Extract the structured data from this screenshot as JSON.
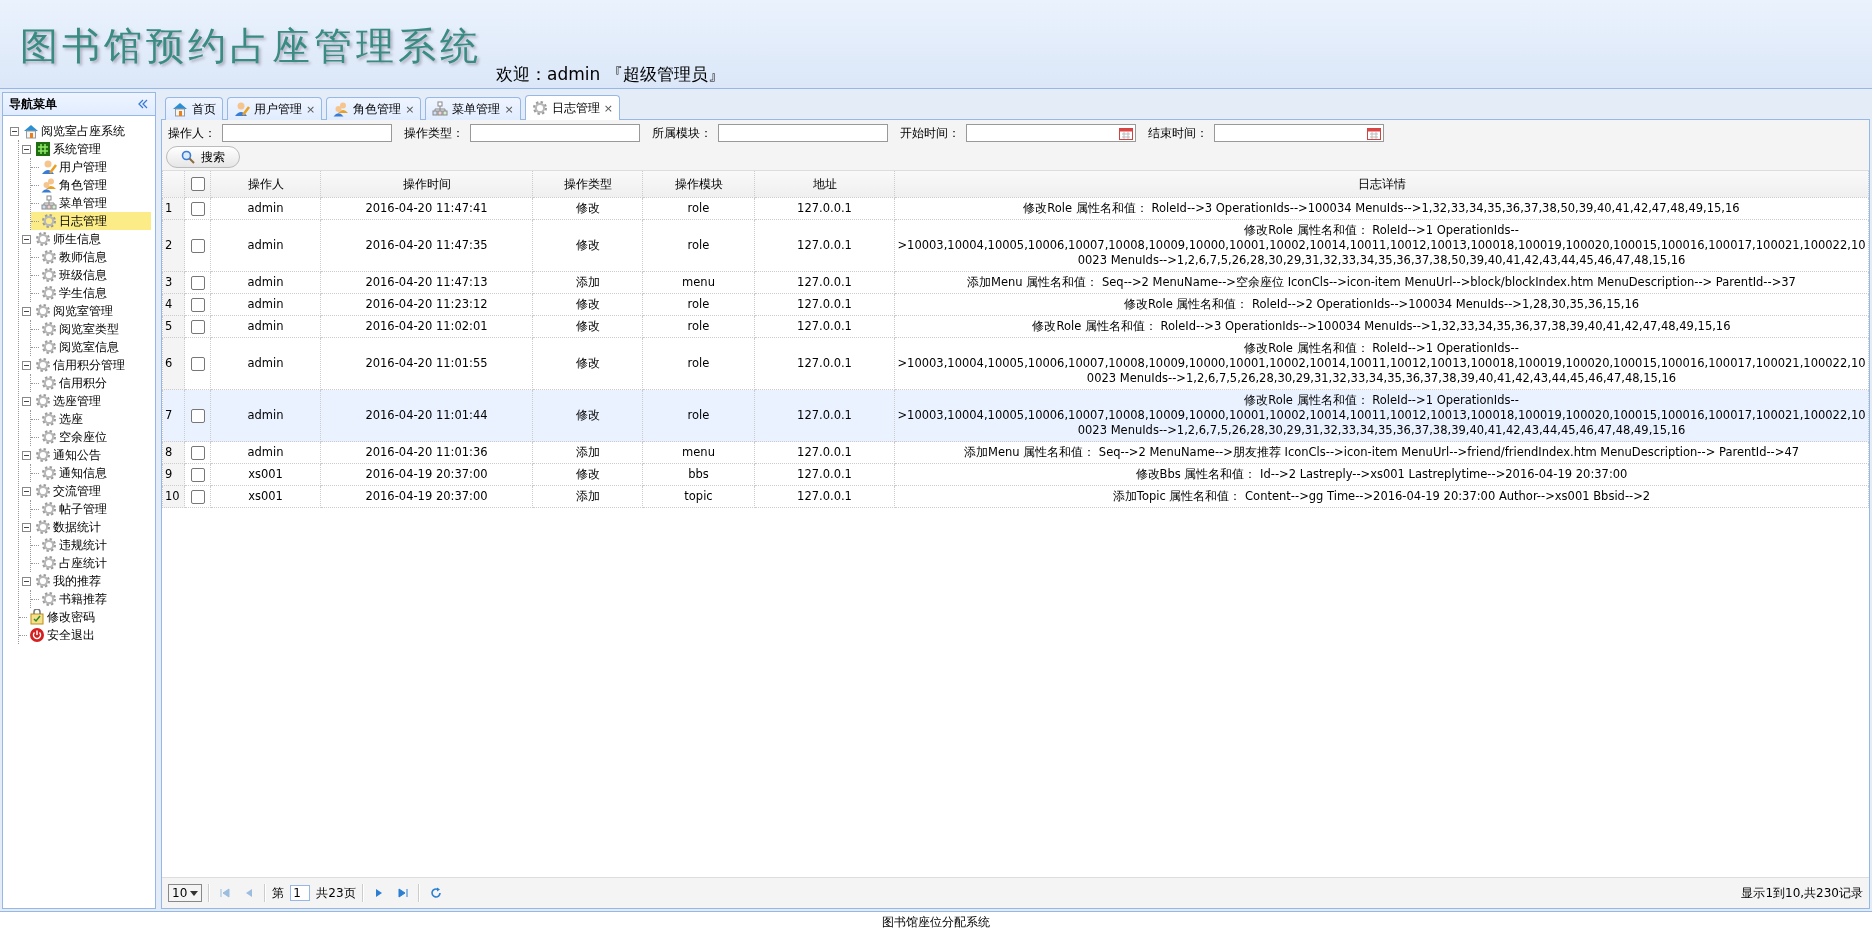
{
  "header": {
    "title": "图书馆预约占座管理系统",
    "welcome": "欢迎：admin 『超级管理员』"
  },
  "sidebar": {
    "title": "导航菜单",
    "tree": [
      {
        "label": "阅览室占座系统",
        "kind": "home",
        "expanded": true,
        "selected": false,
        "children": [
          {
            "label": "系统管理",
            "kind": "hash",
            "expanded": true,
            "selected": false,
            "children": [
              {
                "label": "用户管理",
                "kind": "user",
                "selected": false
              },
              {
                "label": "角色管理",
                "kind": "users",
                "selected": false
              },
              {
                "label": "菜单管理",
                "kind": "sitemap",
                "selected": false
              },
              {
                "label": "日志管理",
                "kind": "gear",
                "selected": true
              }
            ]
          },
          {
            "label": "师生信息",
            "kind": "gear",
            "expanded": true,
            "selected": false,
            "children": [
              {
                "label": "教师信息",
                "kind": "gear",
                "selected": false
              },
              {
                "label": "班级信息",
                "kind": "gear",
                "selected": false
              },
              {
                "label": "学生信息",
                "kind": "gear",
                "selected": false
              }
            ]
          },
          {
            "label": "阅览室管理",
            "kind": "gear",
            "expanded": true,
            "selected": false,
            "children": [
              {
                "label": "阅览室类型",
                "kind": "gear",
                "selected": false
              },
              {
                "label": "阅览室信息",
                "kind": "gear",
                "selected": false
              }
            ]
          },
          {
            "label": "信用积分管理",
            "kind": "gear",
            "expanded": true,
            "selected": false,
            "children": [
              {
                "label": "信用积分",
                "kind": "gear",
                "selected": false
              }
            ]
          },
          {
            "label": "选座管理",
            "kind": "gear",
            "expanded": true,
            "selected": false,
            "children": [
              {
                "label": "选座",
                "kind": "gear",
                "selected": false
              },
              {
                "label": "空余座位",
                "kind": "gear",
                "selected": false
              }
            ]
          },
          {
            "label": "通知公告",
            "kind": "gear",
            "expanded": true,
            "selected": false,
            "children": [
              {
                "label": "通知信息",
                "kind": "gear",
                "selected": false
              }
            ]
          },
          {
            "label": "交流管理",
            "kind": "gear",
            "expanded": true,
            "selected": false,
            "children": [
              {
                "label": "帖子管理",
                "kind": "gear",
                "selected": false
              }
            ]
          },
          {
            "label": "数据统计",
            "kind": "gear",
            "expanded": true,
            "selected": false,
            "children": [
              {
                "label": "违规统计",
                "kind": "gear",
                "selected": false
              },
              {
                "label": "占座统计",
                "kind": "gear",
                "selected": false
              }
            ]
          },
          {
            "label": "我的推荐",
            "kind": "gear",
            "expanded": true,
            "selected": false,
            "children": [
              {
                "label": "书籍推荐",
                "kind": "gear",
                "selected": false
              }
            ]
          },
          {
            "label": "修改密码",
            "kind": "notepad",
            "selected": false
          },
          {
            "label": "安全退出",
            "kind": "power",
            "selected": false
          }
        ]
      }
    ]
  },
  "tabs": [
    {
      "label": "首页",
      "kind": "home",
      "closable": false,
      "selected": false
    },
    {
      "label": "用户管理",
      "kind": "user",
      "closable": true,
      "selected": false
    },
    {
      "label": "角色管理",
      "kind": "users",
      "closable": true,
      "selected": false
    },
    {
      "label": "菜单管理",
      "kind": "sitemap",
      "closable": true,
      "selected": false
    },
    {
      "label": "日志管理",
      "kind": "gear",
      "closable": true,
      "selected": true
    }
  ],
  "close_mark": "×",
  "filters": [
    {
      "label": "操作人：",
      "kind": "text"
    },
    {
      "label": "操作类型：",
      "kind": "text"
    },
    {
      "label": "所属模块：",
      "kind": "text"
    },
    {
      "label": "开始时间：",
      "kind": "date"
    },
    {
      "label": "结束时间：",
      "kind": "date"
    }
  ],
  "search_button": "搜索",
  "table": {
    "select_all_checked": false,
    "columns": [
      "操作人",
      "操作时间",
      "操作类型",
      "操作模块",
      "地址",
      "日志详情"
    ],
    "rows": [
      {
        "num": "1",
        "checked": false,
        "selected": false,
        "cells": [
          "admin",
          "2016-04-20 11:47:41",
          "修改",
          "role",
          "127.0.0.1",
          "修改Role 属性名和值：  RoleId-->3 OperationIds-->100034 MenuIds-->1,32,33,34,35,36,37,38,50,39,40,41,42,47,48,49,15,16"
        ]
      },
      {
        "num": "2",
        "checked": false,
        "selected": false,
        "cells": [
          "admin",
          "2016-04-20 11:47:35",
          "修改",
          "role",
          "127.0.0.1",
          "修改Role 属性名和值：  RoleId-->1 OperationIds-->10003,10004,10005,10006,10007,10008,10009,10000,10001,10002,10014,10011,10012,10013,100018,100019,100020,100015,100016,100017,100021,100022,100023 MenuIds-->1,2,6,7,5,26,28,30,29,31,32,33,34,35,36,37,38,50,39,40,41,42,43,44,45,46,47,48,15,16"
        ]
      },
      {
        "num": "3",
        "checked": false,
        "selected": false,
        "cells": [
          "admin",
          "2016-04-20 11:47:13",
          "添加",
          "menu",
          "127.0.0.1",
          "添加Menu 属性名和值：  Seq-->2 MenuName-->空余座位 IconCls-->icon-item MenuUrl-->block/blockIndex.htm MenuDescription--> ParentId-->37"
        ]
      },
      {
        "num": "4",
        "checked": false,
        "selected": false,
        "cells": [
          "admin",
          "2016-04-20 11:23:12",
          "修改",
          "role",
          "127.0.0.1",
          "修改Role 属性名和值：  RoleId-->2 OperationIds-->100034 MenuIds-->1,28,30,35,36,15,16"
        ]
      },
      {
        "num": "5",
        "checked": false,
        "selected": false,
        "cells": [
          "admin",
          "2016-04-20 11:02:01",
          "修改",
          "role",
          "127.0.0.1",
          "修改Role 属性名和值：  RoleId-->3 OperationIds-->100034 MenuIds-->1,32,33,34,35,36,37,38,39,40,41,42,47,48,49,15,16"
        ]
      },
      {
        "num": "6",
        "checked": false,
        "selected": false,
        "cells": [
          "admin",
          "2016-04-20 11:01:55",
          "修改",
          "role",
          "127.0.0.1",
          "修改Role 属性名和值：  RoleId-->1 OperationIds-->10003,10004,10005,10006,10007,10008,10009,10000,10001,10002,10014,10011,10012,10013,100018,100019,100020,100015,100016,100017,100021,100022,100023 MenuIds-->1,2,6,7,5,26,28,30,29,31,32,33,34,35,36,37,38,39,40,41,42,43,44,45,46,47,48,15,16"
        ]
      },
      {
        "num": "7",
        "checked": false,
        "selected": true,
        "cells": [
          "admin",
          "2016-04-20 11:01:44",
          "修改",
          "role",
          "127.0.0.1",
          "修改Role 属性名和值：  RoleId-->1 OperationIds-->10003,10004,10005,10006,10007,10008,10009,10000,10001,10002,10014,10011,10012,10013,100018,100019,100020,100015,100016,100017,100021,100022,100023 MenuIds-->1,2,6,7,5,26,28,30,29,31,32,33,34,35,36,37,38,39,40,41,42,43,44,45,46,47,48,49,15,16"
        ]
      },
      {
        "num": "8",
        "checked": false,
        "selected": false,
        "cells": [
          "admin",
          "2016-04-20 11:01:36",
          "添加",
          "menu",
          "127.0.0.1",
          "添加Menu 属性名和值：  Seq-->2 MenuName-->朋友推荐 IconCls-->icon-item MenuUrl-->friend/friendIndex.htm MenuDescription--> ParentId-->47"
        ]
      },
      {
        "num": "9",
        "checked": false,
        "selected": false,
        "cells": [
          "xs001",
          "2016-04-19 20:37:00",
          "修改",
          "bbs",
          "127.0.0.1",
          "修改Bbs 属性名和值：  Id-->2 Lastreply-->xs001 Lastreplytime-->2016-04-19 20:37:00"
        ]
      },
      {
        "num": "10",
        "checked": false,
        "selected": false,
        "cells": [
          "xs001",
          "2016-04-19 20:37:00",
          "添加",
          "topic",
          "127.0.0.1",
          "添加Topic 属性名和值：  Content-->gg Time-->2016-04-19 20:37:00 Author-->xs001 Bbsid-->2"
        ]
      }
    ]
  },
  "pager": {
    "page_size": "10",
    "page_prefix": "第",
    "page": "1",
    "page_count": "共23页",
    "summary": "显示1到10,共230记录"
  },
  "footer": "图书馆座位分配系统"
}
